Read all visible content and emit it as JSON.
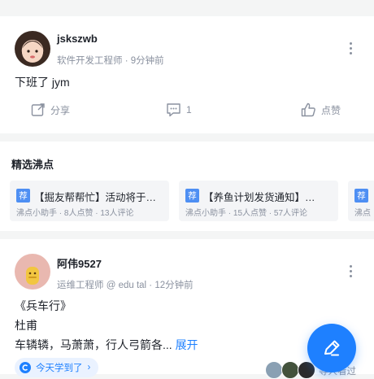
{
  "post1": {
    "username": "jskszwb",
    "title": "软件开发工程师",
    "time": "9分钟前",
    "content": "下班了 jym",
    "actions": {
      "share_label": "分享",
      "comment_count": "1",
      "like_label": "点赞"
    }
  },
  "featured": {
    "section_title": "精选沸点",
    "items": [
      {
        "tag": "荐",
        "title": "【掘友帮帮忙】活动将于…",
        "author": "沸点小助手",
        "likes": "8人点赞",
        "comments": "13人评论"
      },
      {
        "tag": "荐",
        "title": "【养鱼计划发货通知】…",
        "author": "沸点小助手",
        "likes": "15人点赞",
        "comments": "57人评论"
      },
      {
        "tag": "荐",
        "title": "",
        "author": "沸点",
        "likes": "",
        "comments": ""
      }
    ]
  },
  "post2": {
    "username": "阿伟9527",
    "title": "运维工程师 @ edu tal",
    "time": "12分钟前",
    "lines": [
      "《兵车行》",
      "杜甫",
      "车辚辚，马萧萧，行人弓箭各..."
    ],
    "expand_label": "展开",
    "topic_label": "今天学到了",
    "viewers_label": "等人看过"
  },
  "colors": {
    "accent": "#1e80ff",
    "tag": "#4e8ff3",
    "muted": "#8a919f",
    "background": "#f4f5f5"
  },
  "icons": [
    "share-icon",
    "comment-icon",
    "like-icon",
    "more-icon",
    "edit-icon",
    "topic-icon"
  ]
}
